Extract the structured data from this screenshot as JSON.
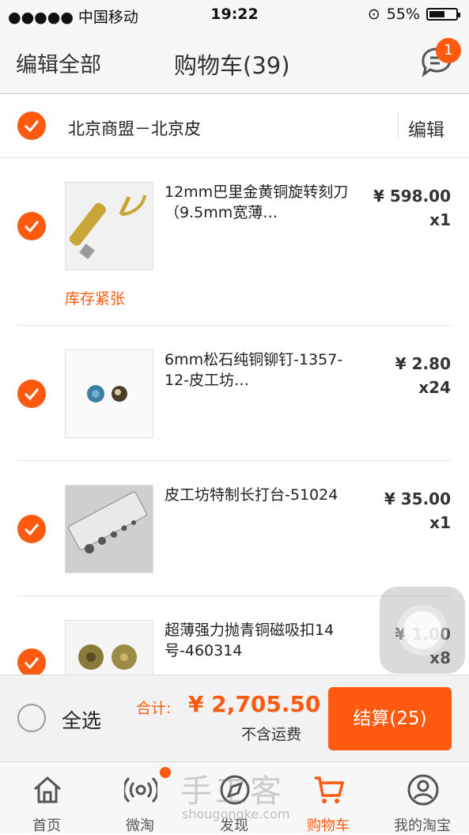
{
  "status_bar": {
    "carrier": "●●●●● 中国移动",
    "time": "19:22",
    "battery": "55%"
  },
  "nav": {
    "edit_all": "编辑全部",
    "title": "购物车(39)",
    "message_badge": "1"
  },
  "shop": {
    "name": "北京商盟－北京皮",
    "edit": "编辑"
  },
  "items": [
    {
      "title": "12mm巴里金黄铜旋转刻刀（9.5mm宽薄…",
      "price": "¥ 598.00",
      "qty": "x1",
      "stock": "库存紧张"
    },
    {
      "title": "6mm松石纯铜铆钉-1357-12-皮工坊…",
      "price": "¥ 2.80",
      "qty": "x24"
    },
    {
      "title": "皮工坊特制长打台-51024",
      "price": "¥ 35.00",
      "qty": "x1"
    },
    {
      "title": "超薄强力抛青铜磁吸扣14号-460314",
      "price": "¥ 1.00",
      "qty": "x8"
    }
  ],
  "bottom": {
    "select_all": "全选",
    "total_label": "合计:",
    "total_value": "¥ 2,705.50",
    "shipping_note": "不含运费",
    "checkout": "结算(25)"
  },
  "tabs": [
    {
      "label": "首页",
      "icon": "home-icon"
    },
    {
      "label": "微淘",
      "icon": "broadcast-icon"
    },
    {
      "label": "发现",
      "icon": "discover-icon"
    },
    {
      "label": "购物车",
      "icon": "cart-icon"
    },
    {
      "label": "我的淘宝",
      "icon": "profile-icon"
    }
  ],
  "watermark": {
    "text": "手工客",
    "url": "shougongke.com"
  },
  "colors": {
    "accent": "#ff5a0f"
  }
}
